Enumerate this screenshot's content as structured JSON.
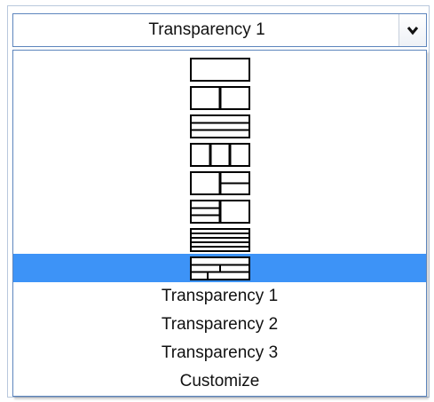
{
  "dropdown": {
    "selected_value": "Transparency 1",
    "arrow_icon": "chevron-down-icon",
    "highlight_color": "#3d93f7",
    "border_color": "#5d85bd",
    "pattern_options": [
      {
        "icon": "pattern-plain-icon"
      },
      {
        "icon": "pattern-vertical-split-icon"
      },
      {
        "icon": "pattern-three-stripes-icon"
      },
      {
        "icon": "pattern-three-columns-icon"
      },
      {
        "icon": "pattern-right-split-icon"
      },
      {
        "icon": "pattern-left-split-icon"
      },
      {
        "icon": "pattern-many-stripes-icon"
      },
      {
        "icon": "pattern-brick-icon",
        "selected": true
      }
    ],
    "text_options": [
      "Transparency 1",
      "Transparency 2",
      "Transparency 3",
      "Customize"
    ]
  }
}
